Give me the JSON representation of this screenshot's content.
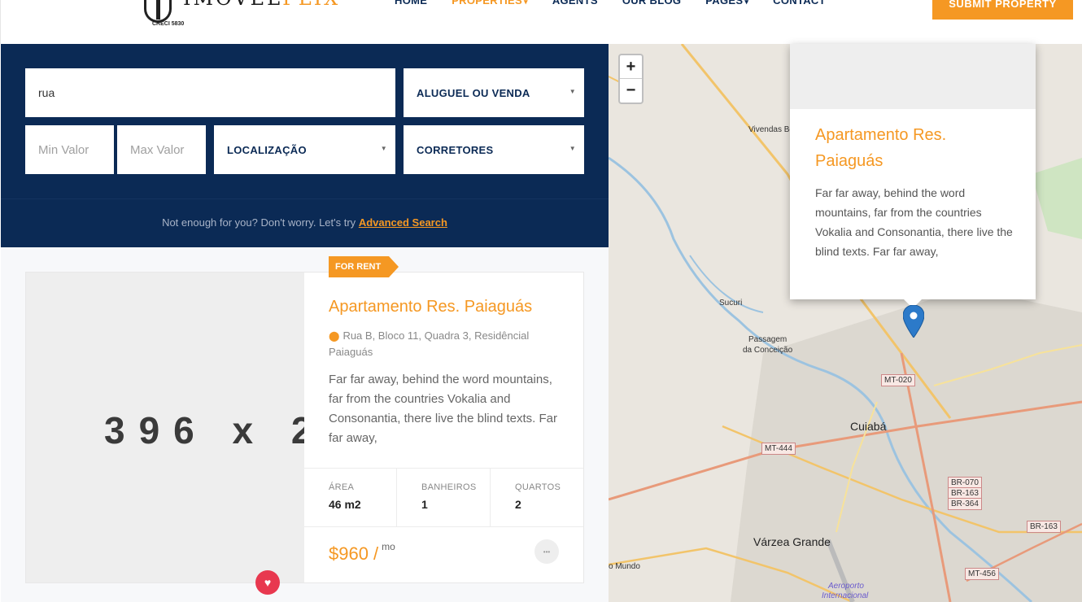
{
  "header": {
    "logo_text_main": "IMOVEL",
    "logo_text_accent": "FLIX",
    "logo_creci": "CRECI 5830",
    "nav": [
      {
        "label": "HOME"
      },
      {
        "label": "PROPERTIES"
      },
      {
        "label": "AGENTS"
      },
      {
        "label": "OUR BLOG"
      },
      {
        "label": "PAGES"
      },
      {
        "label": "CONTACT"
      }
    ],
    "submit_label": "SUBMIT PROPERTY"
  },
  "search": {
    "keyword_value": "rua",
    "type_select": "ALUGUEL OU VENDA",
    "min_placeholder": "Min Valor",
    "max_placeholder": "Max Valor",
    "location_select": "LOCALIZAÇÃO",
    "brokers_select": "CORRETORES",
    "advanced_prefix": "Not enough for you? Don't worry. Let's try",
    "advanced_link": "Advanced Search"
  },
  "listing": {
    "image_placeholder": "396 x 2",
    "badge": "FOR RENT",
    "title": "Apartamento Res. Paiaguás",
    "address": "Rua B, Bloco 11, Quadra 3, Residêncial Paiaguás",
    "description": "Far far away, behind the word mountains, far from the countries Vokalia and Consonantia, there live the blind texts. Far far away,",
    "stats": [
      {
        "label": "ÁREA",
        "value": "46 m2"
      },
      {
        "label": "BANHEIROS",
        "value": "1"
      },
      {
        "label": "QUARTOS",
        "value": "2"
      }
    ],
    "price": "$960 /",
    "price_unit": "mo"
  },
  "map": {
    "zoom_in": "+",
    "zoom_out": "−",
    "popup_title": "Apartamento Res. Paiaguás",
    "popup_desc": "Far far away, behind the word mountains, far from the countries Vokalia and Consonantia, there live the blind texts. Far far away,",
    "labels": {
      "vivendas": "Vivendas Boa",
      "sucuri": "Sucuri",
      "passagem1": "Passagem",
      "passagem2": "da Conceição",
      "cuiaba": "Cuiabá",
      "varzea": "Várzea Grande",
      "mundo": "o Mundo",
      "aeroporto1": "Aeroporto",
      "aeroporto2": "Internacional"
    },
    "shields": {
      "mt020": "MT-020",
      "mt444": "MT-444",
      "br070": "BR-070",
      "br163a": "BR-163",
      "br364": "BR-364",
      "br163b": "BR-163",
      "mt456": "MT-456"
    }
  },
  "colors": {
    "accent": "#f59823",
    "navy": "#0b2a55",
    "heart": "#e8384f",
    "marker": "#2c7ac9"
  }
}
